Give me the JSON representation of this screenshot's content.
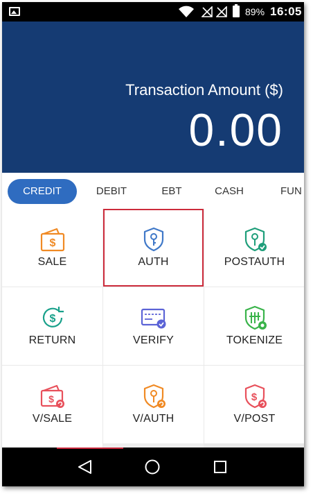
{
  "status_bar": {
    "battery_percent": "89%",
    "time": "16:05",
    "icons": [
      "gallery-icon",
      "wifi-icon",
      "signal-off-icon",
      "signal-off-icon",
      "battery-icon"
    ]
  },
  "amount": {
    "label": "Transaction Amount ($)",
    "value": "0.00"
  },
  "tabs": [
    {
      "label": "CREDIT",
      "active": true
    },
    {
      "label": "DEBIT",
      "active": false
    },
    {
      "label": "EBT",
      "active": false
    },
    {
      "label": "CASH",
      "active": false
    },
    {
      "label": "FUN",
      "active": false
    }
  ],
  "actions": [
    {
      "label": "SALE",
      "icon": "wallet-dollar-icon",
      "color": "#f08a24"
    },
    {
      "label": "AUTH",
      "icon": "shield-key-icon",
      "color": "#3f78c8",
      "selected": true
    },
    {
      "label": "POSTAUTH",
      "icon": "shield-key-check-icon",
      "color": "#1e9e7a"
    },
    {
      "label": "RETURN",
      "icon": "refund-dollar-icon",
      "color": "#18a08a"
    },
    {
      "label": "VERIFY",
      "icon": "card-check-icon",
      "color": "#5b63d6"
    },
    {
      "label": "TOKENIZE",
      "icon": "shield-chip-icon",
      "color": "#39b34a"
    },
    {
      "label": "V/SALE",
      "icon": "wallet-void-icon",
      "color": "#e8505b"
    },
    {
      "label": "V/AUTH",
      "icon": "shield-key-void-icon",
      "color": "#f08a24"
    },
    {
      "label": "V/POST",
      "icon": "shield-dollar-void-icon",
      "color": "#e8505b"
    }
  ],
  "nav": {
    "icons": [
      "back-icon",
      "home-icon",
      "recent-apps-icon"
    ],
    "indicator_color": "#c9263a"
  },
  "colors": {
    "header_bg": "#153b73",
    "tab_active": "#2f6cc0",
    "selection_border": "#cc2b3b"
  }
}
